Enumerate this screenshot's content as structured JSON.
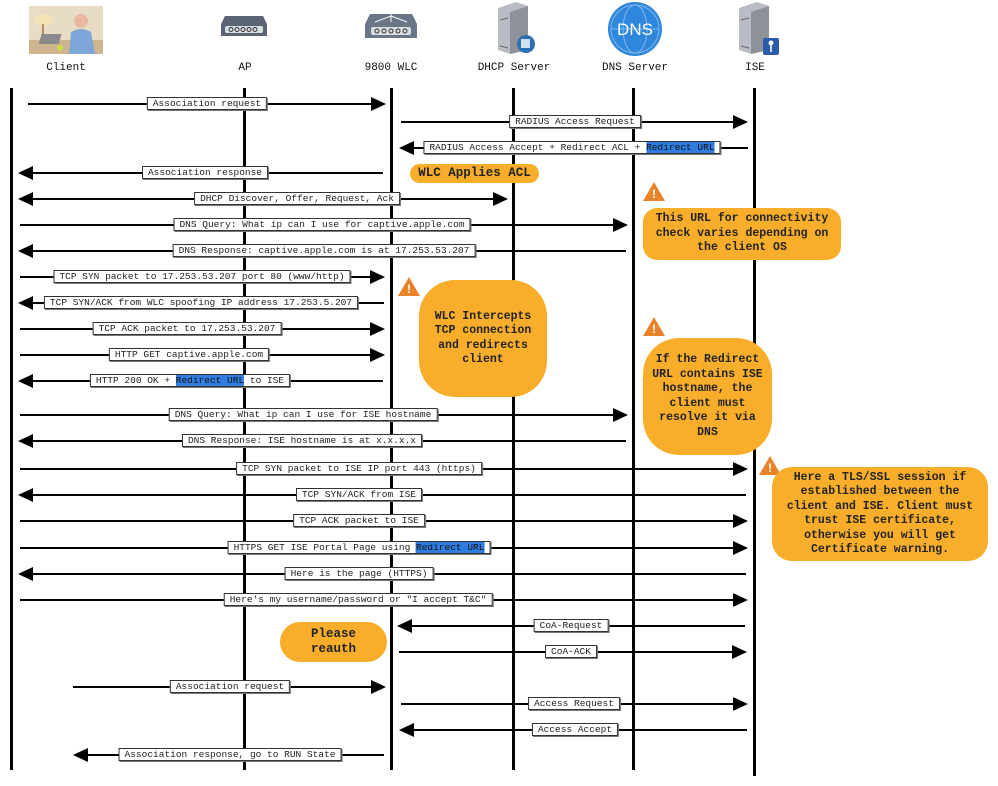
{
  "actors": [
    {
      "id": "client",
      "label": "Client",
      "icon": "person-at-laptop-photo"
    },
    {
      "id": "ap",
      "label": "AP",
      "icon": "access-point-icon"
    },
    {
      "id": "wlc",
      "label": "9800 WLC",
      "icon": "wireless-controller-icon"
    },
    {
      "id": "dhcp",
      "label": "DHCP Server",
      "icon": "dhcp-server-icon"
    },
    {
      "id": "dns",
      "label": "DNS Server",
      "icon": "dns-globe-icon",
      "icon_text": "DNS"
    },
    {
      "id": "ise",
      "label": "ISE",
      "icon": "ise-server-key-icon"
    }
  ],
  "messages": [
    {
      "text": "Association request",
      "from": "client",
      "to": "wlc",
      "dir": "right"
    },
    {
      "text": "RADIUS Access Request",
      "from": "wlc",
      "to": "ise",
      "dir": "right"
    },
    {
      "text": "RADIUS Access Accept + Redirect ACL + ",
      "highlight": "Redirect URL",
      "from": "ise",
      "to": "wlc",
      "dir": "left"
    },
    {
      "text": "Association response",
      "from": "wlc",
      "to": "client",
      "dir": "left"
    },
    {
      "text": "DHCP Discover, Offer, Request, Ack",
      "from": "client",
      "to": "dhcp",
      "dir": "both"
    },
    {
      "text": "DNS Query: What ip can I use for captive.apple.com",
      "from": "client",
      "to": "dns",
      "dir": "right"
    },
    {
      "text": "DNS Response: captive.apple.com is at 17.253.53.207",
      "from": "dns",
      "to": "client",
      "dir": "left"
    },
    {
      "text": "TCP SYN packet to 17.253.53.207 port 80 (www/http)",
      "from": "client",
      "to": "wlc",
      "dir": "right"
    },
    {
      "text": "TCP SYN/ACK from WLC spoofing IP address 17.253.5.207",
      "from": "wlc",
      "to": "client",
      "dir": "left"
    },
    {
      "text": "TCP ACK packet to 17.253.53.207",
      "from": "client",
      "to": "wlc",
      "dir": "right"
    },
    {
      "text": "HTTP GET captive.apple.com",
      "from": "client",
      "to": "wlc",
      "dir": "right"
    },
    {
      "text": "HTTP 200 OK + ",
      "highlight": "Redirect URL",
      "suffix": " to ISE",
      "from": "wlc",
      "to": "client",
      "dir": "left"
    },
    {
      "text": "DNS Query: What ip can I use for ISE hostname",
      "from": "client",
      "to": "dns",
      "dir": "right"
    },
    {
      "text": "DNS Response: ISE hostname is at x.x.x.x",
      "from": "dns",
      "to": "client",
      "dir": "left"
    },
    {
      "text": "TCP SYN packet to ISE IP port 443 (https)",
      "from": "client",
      "to": "ise",
      "dir": "right"
    },
    {
      "text": "TCP SYN/ACK from ISE",
      "from": "ise",
      "to": "client",
      "dir": "left"
    },
    {
      "text": "TCP ACK packet to ISE",
      "from": "client",
      "to": "ise",
      "dir": "right"
    },
    {
      "text": "HTTPS GET ISE Portal Page using ",
      "highlight": "Redirect URL",
      "from": "client",
      "to": "ise",
      "dir": "right"
    },
    {
      "text": "Here is the page (HTTPS)",
      "from": "ise",
      "to": "client",
      "dir": "left"
    },
    {
      "text": "Here's my username/password or \"I accept T&C\"",
      "from": "client",
      "to": "ise",
      "dir": "right"
    },
    {
      "text": "CoA-Request",
      "from": "ise",
      "to": "wlc",
      "dir": "left"
    },
    {
      "text": "CoA-ACK",
      "from": "wlc",
      "to": "ise",
      "dir": "right"
    },
    {
      "text": "Association request",
      "from": "client",
      "to": "wlc",
      "dir": "right"
    },
    {
      "text": "Access Request",
      "from": "wlc",
      "to": "ise",
      "dir": "right"
    },
    {
      "text": "Access Accept",
      "from": "ise",
      "to": "wlc",
      "dir": "left"
    },
    {
      "text": "Association response, go to RUN State",
      "from": "wlc",
      "to": "client",
      "dir": "left"
    }
  ],
  "notes": [
    {
      "text": "WLC Applies ACL",
      "warning": false
    },
    {
      "text": "This URL for connectivity check varies depending on the client OS",
      "warning": true
    },
    {
      "text": "WLC Intercepts TCP connection and redirects client",
      "warning": true
    },
    {
      "text": "If the Redirect URL contains ISE hostname, the client must resolve it via DNS",
      "warning": true
    },
    {
      "text": "Here a TLS/SSL session if established between the client and ISE. Client must trust ISE certificate, otherwise you will get Certificate warning.",
      "warning": true
    },
    {
      "text": "Please reauth",
      "warning": false
    }
  ],
  "colors": {
    "note_fill": "#f8ae2a",
    "warning": "#e8832a",
    "highlight": "#2f7de1",
    "line": "#000000"
  }
}
